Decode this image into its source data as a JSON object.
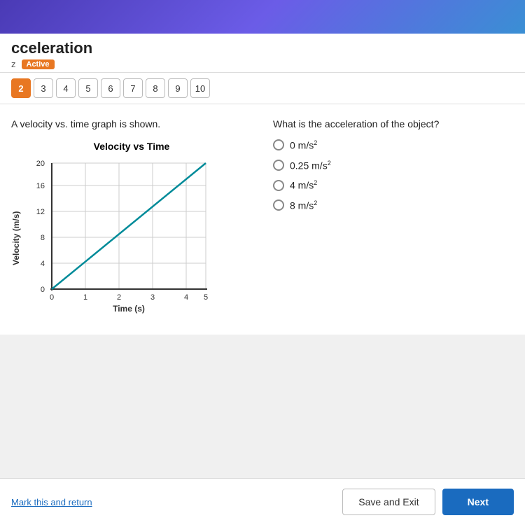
{
  "topbar": {},
  "header": {
    "title": "cceleration",
    "quiz_label": "z",
    "status": "Active"
  },
  "nav": {
    "current": 2,
    "items": [
      2,
      3,
      4,
      5,
      6,
      7,
      8,
      9,
      10
    ]
  },
  "question": {
    "prompt": "A velocity vs. time graph is shown.",
    "answer_prompt": "What is the acceleration of the object?",
    "options": [
      {
        "id": "a",
        "label": "0 m/s²"
      },
      {
        "id": "b",
        "label": "0.25 m/s²"
      },
      {
        "id": "c",
        "label": "4 m/s²"
      },
      {
        "id": "d",
        "label": "8 m/s²"
      }
    ]
  },
  "graph": {
    "title": "Velocity vs Time",
    "x_label": "Time (s)",
    "y_label": "Velocity (m/s)",
    "x_ticks": [
      0,
      1,
      2,
      3,
      4,
      5
    ],
    "y_ticks": [
      0,
      4,
      8,
      12,
      16,
      20
    ]
  },
  "footer": {
    "mark_link": "Mark this and return",
    "save_button": "Save and Exit",
    "next_button": "Next"
  }
}
